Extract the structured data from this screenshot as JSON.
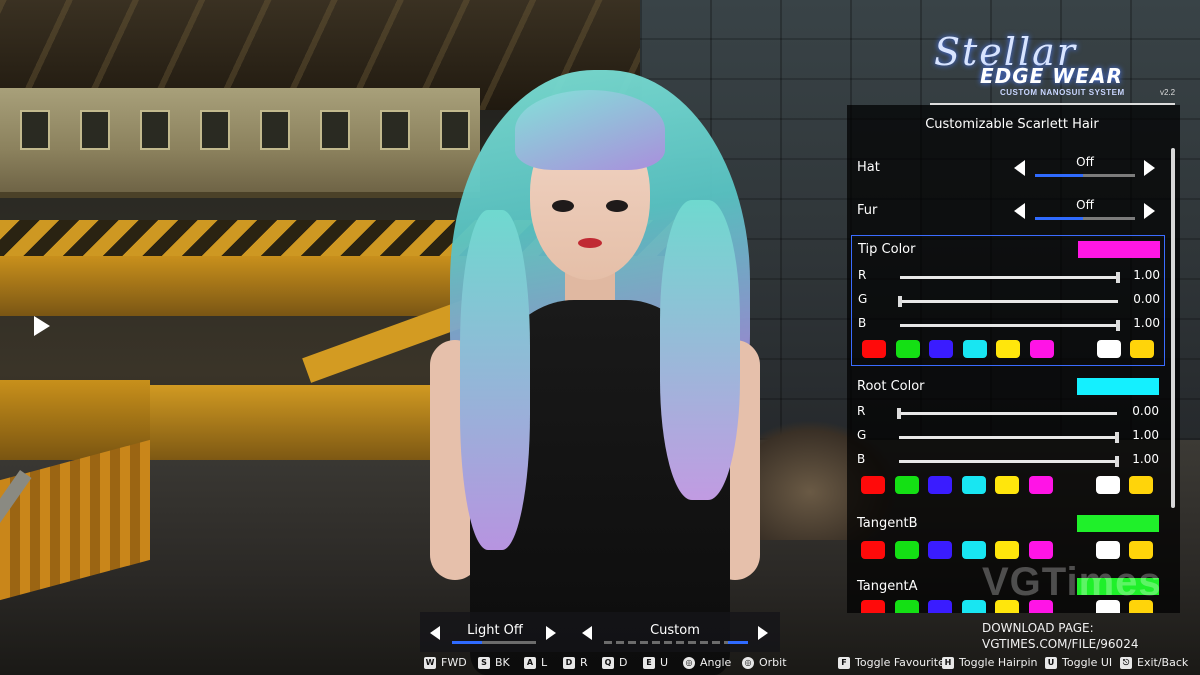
{
  "logo": {
    "script": "Stellar",
    "main": "EDGE WEAR",
    "sub": "CUSTOM NANOSUIT SYSTEM",
    "version": "v2.2"
  },
  "panel": {
    "title": "Customizable Scarlett Hair",
    "options": [
      {
        "label": "Hat",
        "value": "Off"
      },
      {
        "label": "Fur",
        "value": "Off"
      }
    ],
    "color_blocks": [
      {
        "title": "Tip Color",
        "swatch": "#ff17e4",
        "selected": true,
        "sliders": [
          {
            "label": "R",
            "value": "1.00",
            "level": 1.0
          },
          {
            "label": "G",
            "value": "0.00",
            "level": 0.0
          },
          {
            "label": "B",
            "value": "1.00",
            "level": 1.0
          }
        ]
      },
      {
        "title": "Root Color",
        "swatch": "#14f0ff",
        "selected": false,
        "sliders": [
          {
            "label": "R",
            "value": "0.00",
            "level": 0.0
          },
          {
            "label": "G",
            "value": "1.00",
            "level": 1.0
          },
          {
            "label": "B",
            "value": "1.00",
            "level": 1.0
          }
        ]
      },
      {
        "title": "TangentB",
        "swatch": "#1ff02a",
        "selected": false,
        "sliders": []
      },
      {
        "title": "TangentA",
        "swatch": "#1ff02a",
        "selected": false,
        "sliders": []
      }
    ],
    "palette": [
      "#ff0a0a",
      "#14e014",
      "#3a1cff",
      "#18e6f2",
      "#ffe60c",
      "#ff14e6",
      "",
      "#ffffff",
      "#ffd40a"
    ]
  },
  "bottom": {
    "light_label": "Light Off",
    "custom_label": "Custom"
  },
  "download": {
    "line1": "DOWNLOAD PAGE:",
    "line2": "VGTIMES.COM/FILE/96024"
  },
  "watermark": "VGTimes",
  "controls": [
    {
      "key": "W",
      "label": "FWD"
    },
    {
      "key": "S",
      "label": "BK"
    },
    {
      "key": "A",
      "label": "L"
    },
    {
      "key": "D",
      "label": "R"
    },
    {
      "key": "Q",
      "label": "D"
    },
    {
      "key": "E",
      "label": "U"
    },
    {
      "key": "◎",
      "label": "Angle"
    },
    {
      "key": "◎",
      "label": "Orbit"
    },
    {
      "key": "F",
      "label": "Toggle Favourite"
    },
    {
      "key": "H",
      "label": "Toggle Hairpin"
    },
    {
      "key": "U",
      "label": "Toggle UI"
    },
    {
      "key": "Esc",
      "label": "Exit/Back"
    }
  ],
  "colors": {
    "accent": "#2f6bff",
    "panel_bg": "rgba(0,0,0,0.72)"
  }
}
